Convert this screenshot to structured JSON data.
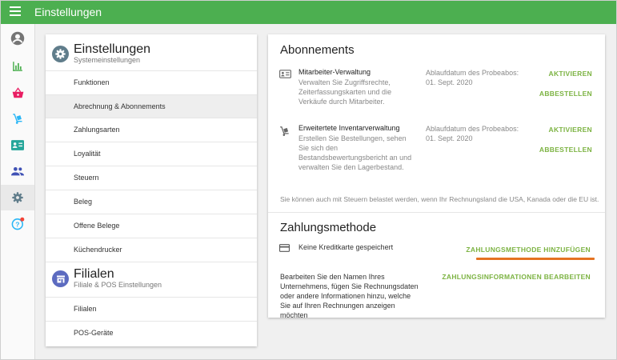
{
  "header": {
    "title": "Einstellungen"
  },
  "sidebar": {
    "items": [
      {
        "icon": "account-circle-icon",
        "color": "#757575"
      },
      {
        "icon": "bar-chart-icon",
        "color": "#4caf50"
      },
      {
        "icon": "basket-icon",
        "color": "#e91e63"
      },
      {
        "icon": "hand-truck-icon",
        "color": "#29b6f6"
      },
      {
        "icon": "contact-card-icon",
        "color": "#26a69a"
      },
      {
        "icon": "people-icon",
        "color": "#3f51b5"
      },
      {
        "icon": "gear-icon",
        "color": "#607d8b",
        "active": true
      },
      {
        "icon": "help-icon",
        "color": "#29b6f6",
        "badge_color": "#f44336"
      }
    ]
  },
  "settings": {
    "title": "Einstellungen",
    "subtitle": "Systemeinstellungen",
    "items": [
      "Funktionen",
      "Abrechnung & Abonnements",
      "Zahlungsarten",
      "Loyalität",
      "Steuern",
      "Beleg",
      "Offene Belege",
      "Küchendrucker"
    ]
  },
  "stores": {
    "title": "Filialen",
    "subtitle": "Filiale & POS Einstellungen",
    "items": [
      "Filialen",
      "POS-Geräte"
    ]
  },
  "subscriptions": {
    "title": "Abonnements",
    "items": [
      {
        "name": "Mitarbeiter-Verwaltung",
        "description": "Verwalten Sie Zugriffsrechte, Zeiterfassungskarten und die Verkäufe durch Mitarbeiter.",
        "expiry": "Ablaufdatum des Probeabos: 01. Sept. 2020",
        "activate": "AKTIVIEREN",
        "cancel": "ABBESTELLEN"
      },
      {
        "name": "Erweitertete Inventarverwaltung",
        "description": "Erstellen Sie Bestellungen, sehen Sie sich den Bestandsbewertungsbericht an und verwalten Sie den Lagerbestand.",
        "expiry": "Ablaufdatum des Probeabos: 01. Sept. 2020",
        "activate": "AKTIVIEREN",
        "cancel": "ABBESTELLEN"
      }
    ],
    "tax_note": "Sie können auch mit Steuern belastet werden, wenn Ihr Rechnungsland die USA, Kanada oder die EU ist."
  },
  "payment": {
    "title": "Zahlungsmethode",
    "card_status": "Keine Kreditkarte gespeichert",
    "add_button": "ZAHLUNGSMETHODE HINZUFÜGEN",
    "description": "Bearbeiten Sie den Namen Ihres Unternehmens, fügen Sie Rechnungsdaten oder andere Informationen hinzu, welche Sie auf Ihren Rechnungen anzeigen möchten",
    "edit_button": "ZAHLUNGSINFORMATIONEN BEARBEITEN"
  },
  "colors": {
    "header": "#4caf50",
    "link": "#7cb342",
    "highlight": "#e57322"
  }
}
